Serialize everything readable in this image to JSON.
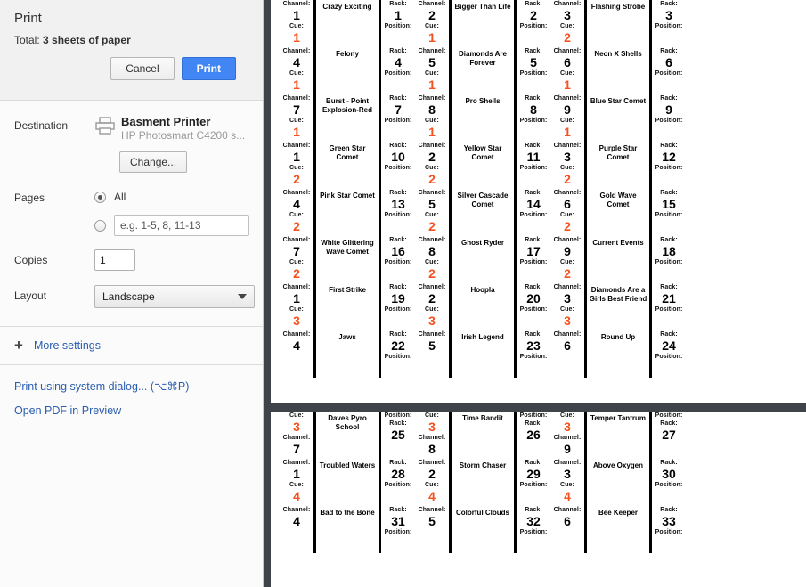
{
  "dialog": {
    "title": "Print",
    "total_label": "Total:",
    "total_value": "3 sheets of paper",
    "cancel_label": "Cancel",
    "print_label": "Print"
  },
  "settings": {
    "destination_label": "Destination",
    "printer_icon": "printer-icon",
    "printer_name": "Basment Printer",
    "printer_model": "HP Photosmart C4200 s...",
    "change_label": "Change...",
    "pages_label": "Pages",
    "pages_all_label": "All",
    "pages_all_selected": true,
    "pages_range_placeholder": "e.g. 1-5, 8, 11-13",
    "pages_range_value": "",
    "copies_label": "Copies",
    "copies_value": "1",
    "layout_label": "Layout",
    "layout_value": "Landscape",
    "more_settings_label": "More settings",
    "plus_icon": "plus-icon",
    "caret_icon": "chevron-down-icon",
    "system_dialog_link": "Print using system dialog... (⌥⌘P)",
    "open_pdf_link": "Open PDF in Preview"
  },
  "preview": {
    "labels": {
      "channel": "Channel:",
      "cue": "Cue:",
      "rack": "Rack:",
      "position": "Position:"
    },
    "cue_color": "#f4511e",
    "page1": {
      "rows": [
        {
          "blocks": [
            {
              "channel": "1",
              "cue": "1",
              "name": "Crazy Exciting",
              "rack": "1"
            },
            {
              "channel": "2",
              "cue": "1",
              "name": "Bigger Than Life",
              "rack": "2"
            },
            {
              "channel": "3",
              "cue": "2",
              "name": "Flashing Strobe",
              "rack": "3"
            }
          ]
        },
        {
          "blocks": [
            {
              "channel": "4",
              "cue": "1",
              "name": "Felony",
              "rack": "4"
            },
            {
              "channel": "5",
              "cue": "1",
              "name": "Diamonds Are Forever",
              "rack": "5"
            },
            {
              "channel": "6",
              "cue": "1",
              "name": "Neon X Shells",
              "rack": "6"
            }
          ]
        },
        {
          "blocks": [
            {
              "channel": "7",
              "cue": "1",
              "name": "Burst - Point Explosion-Red",
              "rack": "7"
            },
            {
              "channel": "8",
              "cue": "1",
              "name": "Pro Shells",
              "rack": "8"
            },
            {
              "channel": "9",
              "cue": "1",
              "name": "Blue Star Comet",
              "rack": "9"
            }
          ]
        },
        {
          "blocks": [
            {
              "channel": "1",
              "cue": "2",
              "name": "Green Star Comet",
              "rack": "10"
            },
            {
              "channel": "2",
              "cue": "2",
              "name": "Yellow Star Comet",
              "rack": "11"
            },
            {
              "channel": "3",
              "cue": "2",
              "name": "Purple Star Comet",
              "rack": "12"
            }
          ]
        },
        {
          "blocks": [
            {
              "channel": "4",
              "cue": "2",
              "name": "Pink Star Comet",
              "rack": "13"
            },
            {
              "channel": "5",
              "cue": "2",
              "name": "Silver Cascade Comet",
              "rack": "14"
            },
            {
              "channel": "6",
              "cue": "2",
              "name": "Gold Wave Comet",
              "rack": "15"
            }
          ]
        },
        {
          "blocks": [
            {
              "channel": "7",
              "cue": "2",
              "name": "White Glittering Wave Comet",
              "rack": "16"
            },
            {
              "channel": "8",
              "cue": "2",
              "name": "Ghost Ryder",
              "rack": "17"
            },
            {
              "channel": "9",
              "cue": "2",
              "name": "Current Events",
              "rack": "18"
            }
          ]
        },
        {
          "blocks": [
            {
              "channel": "1",
              "cue": "3",
              "name": "First Strike",
              "rack": "19"
            },
            {
              "channel": "2",
              "cue": "3",
              "name": "Hoopla",
              "rack": "20"
            },
            {
              "channel": "3",
              "cue": "3",
              "name": "Diamonds Are a Girls Best Friend",
              "rack": "21"
            }
          ]
        },
        {
          "blocks": [
            {
              "channel": "4",
              "cue": "",
              "name": "Jaws",
              "rack": "22"
            },
            {
              "channel": "5",
              "cue": "",
              "name": "Irish Legend",
              "rack": "23"
            },
            {
              "channel": "6",
              "cue": "",
              "name": "Round Up",
              "rack": "24"
            }
          ]
        }
      ]
    },
    "page2": {
      "rows": [
        {
          "blocks": [
            {
              "channel": "7",
              "cue": "3",
              "name": "Daves Pyro School",
              "rack": "25"
            },
            {
              "channel": "8",
              "cue": "3",
              "name": "Time Bandit",
              "rack": "26"
            },
            {
              "channel": "9",
              "cue": "3",
              "name": "Temper Tantrum",
              "rack": "27"
            }
          ]
        },
        {
          "blocks": [
            {
              "channel": "1",
              "cue": "4",
              "name": "Troubled Waters",
              "rack": "28"
            },
            {
              "channel": "2",
              "cue": "4",
              "name": "Storm Chaser",
              "rack": "29"
            },
            {
              "channel": "3",
              "cue": "4",
              "name": "Above Oxygen",
              "rack": "30"
            }
          ]
        },
        {
          "blocks": [
            {
              "channel": "4",
              "cue": "",
              "name": "Bad to the Bone",
              "rack": "31"
            },
            {
              "channel": "5",
              "cue": "",
              "name": "Colorful Clouds",
              "rack": "32"
            },
            {
              "channel": "6",
              "cue": "",
              "name": "Bee Keeper",
              "rack": "33"
            }
          ]
        }
      ],
      "lead_cue": "3"
    }
  }
}
